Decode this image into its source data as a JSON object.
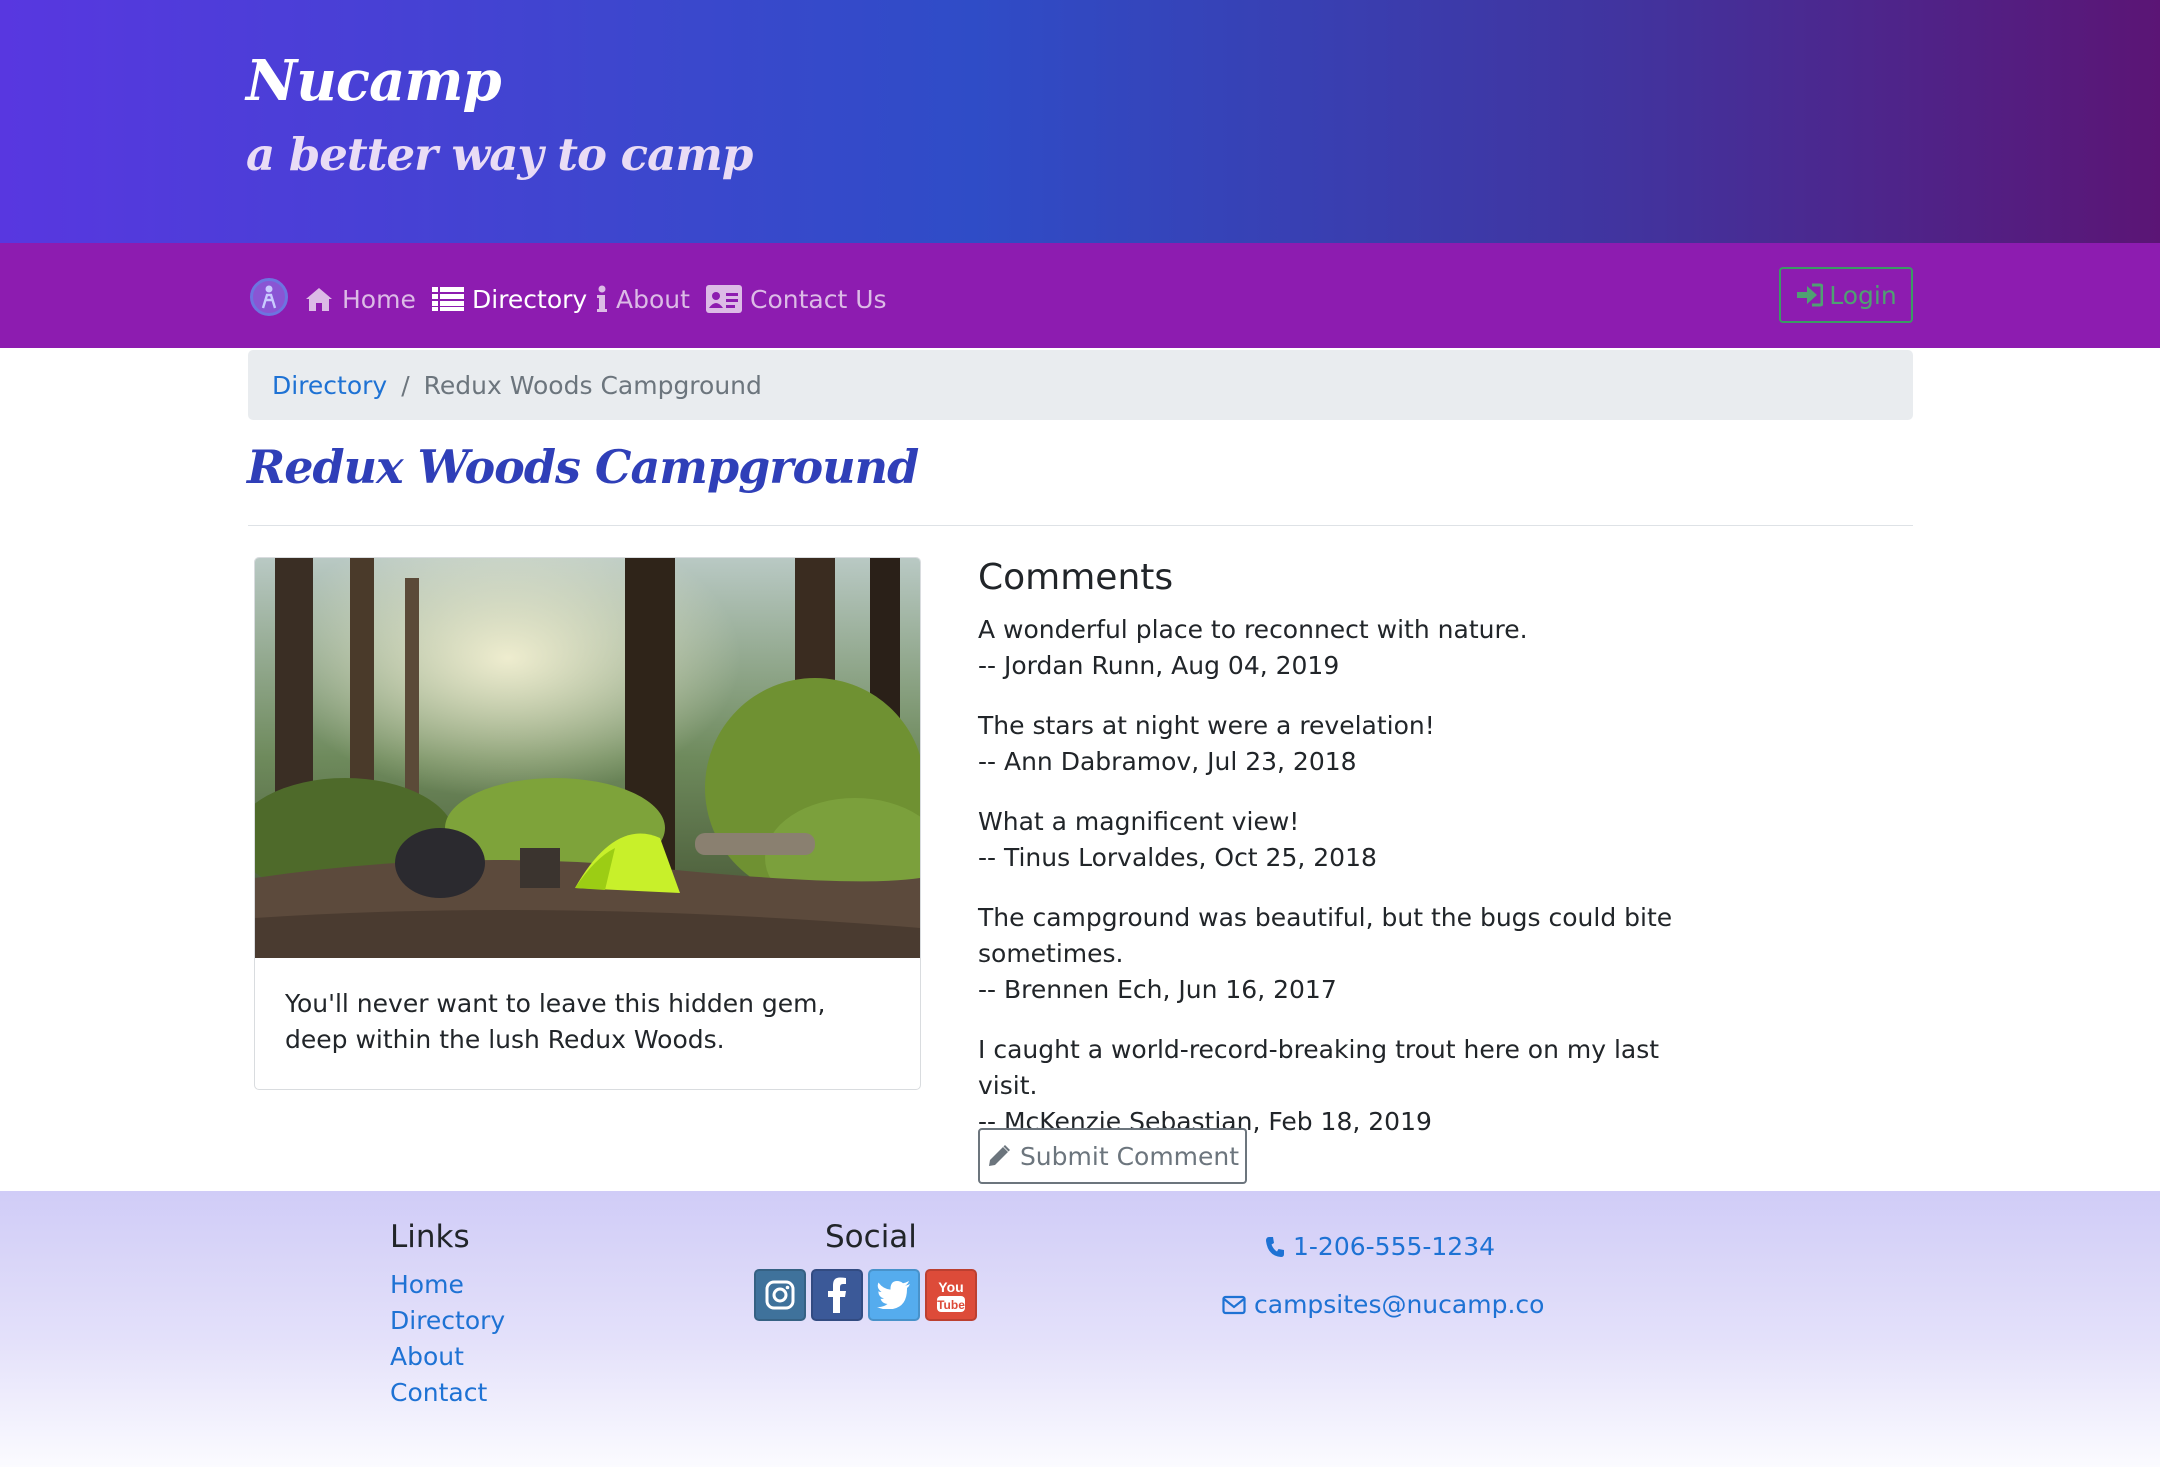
{
  "header": {
    "title": "Nucamp",
    "subtitle": "a better way to camp"
  },
  "navbar": {
    "items": [
      {
        "label": "Home",
        "icon": "home-icon"
      },
      {
        "label": "Directory",
        "icon": "list-icon",
        "active": true
      },
      {
        "label": "About",
        "icon": "info-icon"
      },
      {
        "label": "Contact Us",
        "icon": "address-card-icon"
      }
    ],
    "login_label": "Login"
  },
  "breadcrumb": {
    "link": "Directory",
    "separator": "/",
    "current": "Redux Woods Campground"
  },
  "campsite": {
    "name": "Redux Woods Campground",
    "description": "You'll never want to leave this hidden gem, deep within the lush Redux Woods."
  },
  "comments": {
    "heading": "Comments",
    "items": [
      {
        "text": "A wonderful place to reconnect with nature.",
        "byline": "-- Jordan Runn, Aug 04, 2019"
      },
      {
        "text": "The stars at night were a revelation!",
        "byline": "-- Ann Dabramov, Jul 23, 2018"
      },
      {
        "text": "What a magnificent view!",
        "byline": "-- Tinus Lorvaldes, Oct 25, 2018"
      },
      {
        "text": "The campground was beautiful, but the bugs could bite sometimes.",
        "byline": "-- Brennen Ech, Jun 16, 2017"
      },
      {
        "text": "I caught a world-record-breaking trout here on my last visit.",
        "byline": "-- McKenzie Sebastian, Feb 18, 2019"
      }
    ],
    "submit_label": "Submit Comment"
  },
  "footer": {
    "links_heading": "Links",
    "links": [
      "Home",
      "Directory",
      "About",
      "Contact"
    ],
    "social_heading": "Social",
    "social": [
      {
        "name": "instagram-icon",
        "color": "#3f729b"
      },
      {
        "name": "facebook-icon",
        "color": "#3b5998"
      },
      {
        "name": "twitter-icon",
        "color": "#55acee"
      },
      {
        "name": "youtube-icon",
        "color": "#dd4b39"
      }
    ],
    "youtube_logo_text": "You Tube",
    "phone": "1-206-555-1234",
    "email": "campsites@nucamp.co"
  },
  "colors": {
    "navbar": "#8d1cb0",
    "link": "#1e72d4",
    "title": "#2f3fb8"
  }
}
